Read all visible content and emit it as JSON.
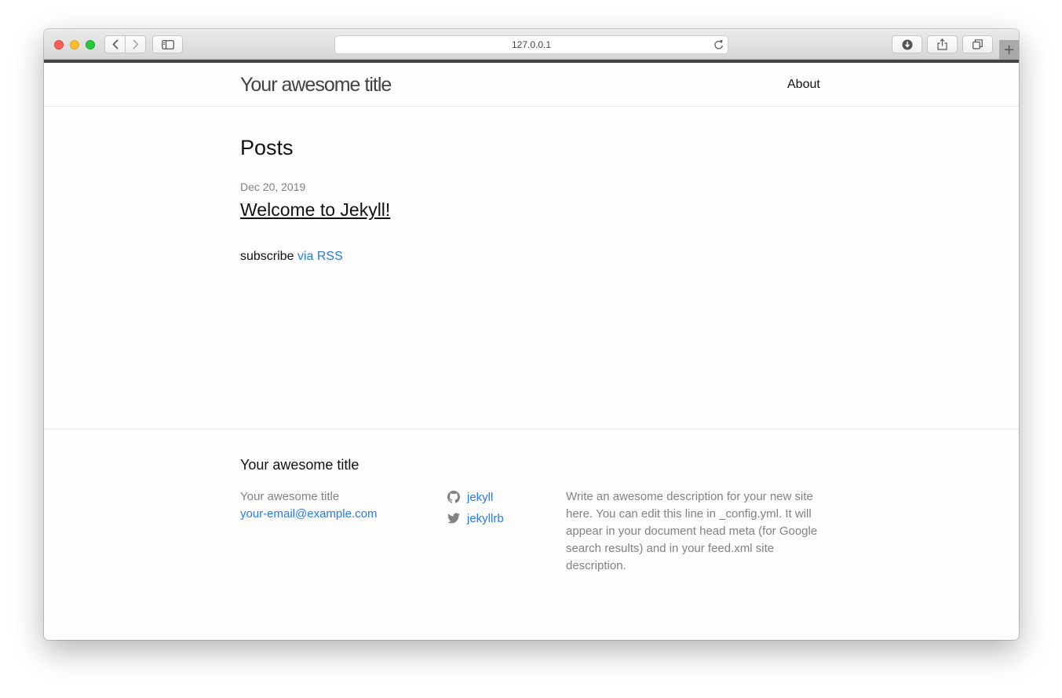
{
  "browser": {
    "url": "127.0.0.1",
    "new_tab_symbol": "+",
    "icons": {
      "back": "chevron-left-icon",
      "forward": "chevron-right-icon",
      "sidebar": "sidebar-icon",
      "reload": "reload-icon",
      "downloads": "download-icon",
      "share": "share-icon",
      "tabs": "tabs-overview-icon"
    }
  },
  "header": {
    "site_title": "Your awesome title",
    "nav": [
      {
        "label": "About"
      }
    ]
  },
  "main": {
    "heading": "Posts",
    "posts": [
      {
        "date": "Dec 20, 2019",
        "title": "Welcome to Jekyll!"
      }
    ],
    "subscribe_text": "subscribe",
    "subscribe_link": "via RSS"
  },
  "footer": {
    "heading": "Your awesome title",
    "name": "Your awesome title",
    "email": "your-email@example.com",
    "social": [
      {
        "icon": "github-icon",
        "label": "jekyll"
      },
      {
        "icon": "twitter-icon",
        "label": "jekyllrb"
      }
    ],
    "description": "Write an awesome description for your new site here. You can edit this line in _config.yml. It will appear in your document head meta (for Google search results) and in your feed.xml site description."
  },
  "colors": {
    "link": "#2a7ae2",
    "muted_text": "#828282",
    "text": "#111111",
    "page_bg": "#fdfdfd"
  }
}
